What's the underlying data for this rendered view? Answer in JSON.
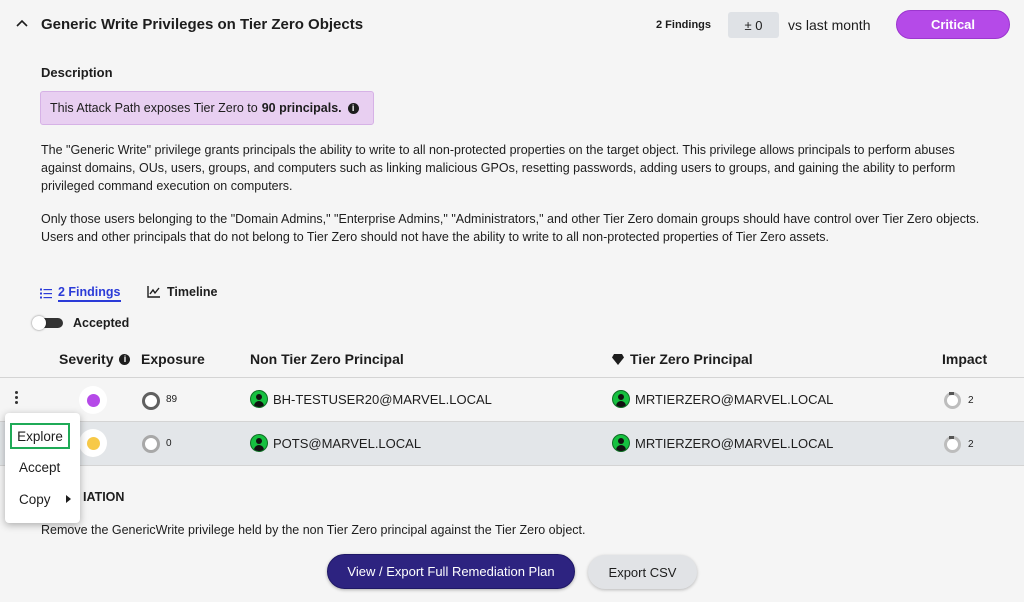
{
  "header": {
    "title": "Generic Write Privileges on Tier Zero Objects",
    "findings_count": "2 Findings",
    "delta": "± 0",
    "vs_label": "vs last month",
    "severity_badge": "Critical"
  },
  "description": {
    "heading": "Description",
    "banner_prefix": "This Attack Path exposes Tier Zero to",
    "banner_bold": "90 principals.",
    "paragraph1": "The \"Generic Write\" privilege grants principals the ability to write to all non-protected properties on the target object. This privilege allows principals to perform abuses against domains, OUs, users, groups, and computers such as linking malicious GPOs, resetting passwords, adding users to groups, and gaining the ability to perform privileged command execution on computers.",
    "paragraph2": "Only those users belonging to the \"Domain Admins,\" \"Enterprise Admins,\" \"Administrators,\" and other Tier Zero domain groups should have control over Tier Zero objects. Users and other principals that do not belong to Tier Zero should not have the ability to write to all non-protected properties of Tier Zero assets."
  },
  "tabs": {
    "findings": "2 Findings",
    "timeline": "Timeline"
  },
  "accepted_toggle": {
    "label": "Accepted",
    "on": false
  },
  "table": {
    "headers": {
      "severity": "Severity",
      "exposure": "Exposure",
      "non_tier_zero": "Non Tier Zero Principal",
      "tier_zero": "Tier Zero Principal",
      "impact": "Impact"
    },
    "rows": [
      {
        "severity_color": "#b54ae8",
        "exposure": "89",
        "non_tier_zero": "BH-TESTUSER20@MARVEL.LOCAL",
        "tier_zero": "MRTIERZERO@MARVEL.LOCAL",
        "impact": "2"
      },
      {
        "severity_color": "#f7c948",
        "exposure": "0",
        "non_tier_zero": "POTS@MARVEL.LOCAL",
        "tier_zero": "MRTIERZERO@MARVEL.LOCAL",
        "impact": "2"
      }
    ]
  },
  "context_menu": {
    "explore": "Explore",
    "accept": "Accept",
    "copy": "Copy"
  },
  "remediation": {
    "heading_visible": "IATION",
    "text": "Remove the GenericWrite privilege held by the non Tier Zero principal against the Tier Zero object."
  },
  "buttons": {
    "export_plan": "View / Export Full Remediation Plan",
    "export_csv": "Export CSV"
  }
}
